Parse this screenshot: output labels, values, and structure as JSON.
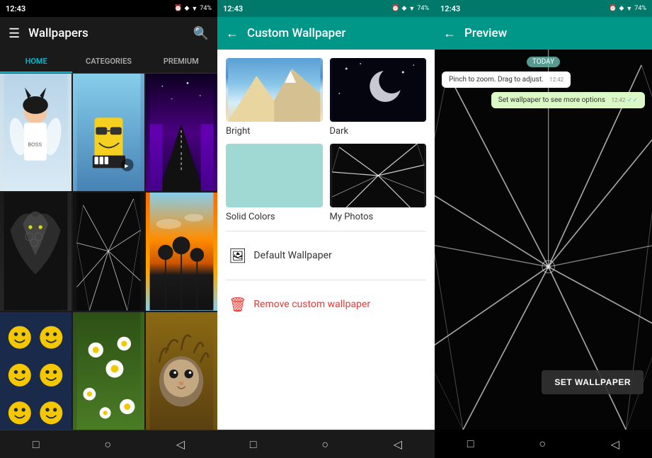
{
  "panel1": {
    "status_time": "12:43",
    "status_icons": "⊡◆▼74%",
    "title": "Wallpapers",
    "tabs": [
      {
        "id": "home",
        "label": "HOME",
        "active": true
      },
      {
        "id": "categories",
        "label": "CATEGORIES",
        "active": false
      },
      {
        "id": "premium",
        "label": "PREMIUM",
        "active": false
      }
    ],
    "nav_buttons": [
      "□",
      "○",
      "◁"
    ],
    "grid_cells": [
      {
        "id": "cell1",
        "type": "anime"
      },
      {
        "id": "cell2",
        "type": "sponge"
      },
      {
        "id": "cell3",
        "type": "purple"
      },
      {
        "id": "cell4",
        "type": "dragon"
      },
      {
        "id": "cell5",
        "type": "glass"
      },
      {
        "id": "cell6",
        "type": "sunset"
      },
      {
        "id": "cell7",
        "type": "smiley"
      },
      {
        "id": "cell8",
        "type": "daisies"
      },
      {
        "id": "cell9",
        "type": "cat"
      }
    ]
  },
  "panel2": {
    "status_time": "12:43",
    "title": "Custom Wallpaper",
    "options": [
      {
        "id": "bright",
        "label": "Bright"
      },
      {
        "id": "dark",
        "label": "Dark"
      },
      {
        "id": "solid",
        "label": "Solid Colors"
      },
      {
        "id": "photos",
        "label": "My Photos"
      }
    ],
    "action_items": [
      {
        "id": "default",
        "icon": "🖼",
        "label": "Default Wallpaper",
        "color": "normal"
      },
      {
        "id": "remove",
        "icon": "🗑",
        "label": "Remove custom wallpaper",
        "color": "red"
      }
    ],
    "nav_buttons": [
      "□",
      "○",
      "◁"
    ]
  },
  "panel3": {
    "status_time": "12:43",
    "title": "Preview",
    "chat": {
      "today_label": "TODAY",
      "messages": [
        {
          "id": "msg1",
          "text": "Pinch to zoom. Drag to adjust.",
          "side": "left",
          "time": "12:42"
        },
        {
          "id": "msg2",
          "text": "Set wallpaper to see more options",
          "side": "right",
          "time": "12:42",
          "check": true
        }
      ]
    },
    "set_wallpaper_button": "SET WALLPAPER",
    "nav_buttons": [
      "□",
      "○",
      "◁"
    ]
  }
}
